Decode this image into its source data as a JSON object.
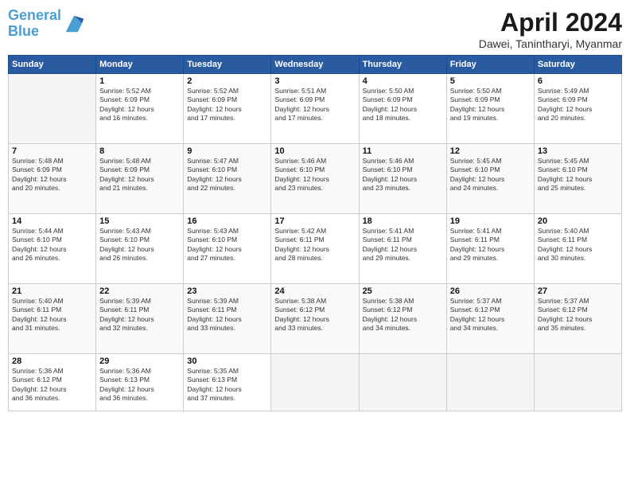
{
  "header": {
    "logo_line1": "General",
    "logo_line2": "Blue",
    "month": "April 2024",
    "location": "Dawei, Tanintharyi, Myanmar"
  },
  "columns": [
    "Sunday",
    "Monday",
    "Tuesday",
    "Wednesday",
    "Thursday",
    "Friday",
    "Saturday"
  ],
  "weeks": [
    [
      {
        "day": "",
        "info": ""
      },
      {
        "day": "1",
        "info": "Sunrise: 5:52 AM\nSunset: 6:09 PM\nDaylight: 12 hours\nand 16 minutes."
      },
      {
        "day": "2",
        "info": "Sunrise: 5:52 AM\nSunset: 6:09 PM\nDaylight: 12 hours\nand 17 minutes."
      },
      {
        "day": "3",
        "info": "Sunrise: 5:51 AM\nSunset: 6:09 PM\nDaylight: 12 hours\nand 17 minutes."
      },
      {
        "day": "4",
        "info": "Sunrise: 5:50 AM\nSunset: 6:09 PM\nDaylight: 12 hours\nand 18 minutes."
      },
      {
        "day": "5",
        "info": "Sunrise: 5:50 AM\nSunset: 6:09 PM\nDaylight: 12 hours\nand 19 minutes."
      },
      {
        "day": "6",
        "info": "Sunrise: 5:49 AM\nSunset: 6:09 PM\nDaylight: 12 hours\nand 20 minutes."
      }
    ],
    [
      {
        "day": "7",
        "info": "Sunrise: 5:48 AM\nSunset: 6:09 PM\nDaylight: 12 hours\nand 20 minutes."
      },
      {
        "day": "8",
        "info": "Sunrise: 5:48 AM\nSunset: 6:09 PM\nDaylight: 12 hours\nand 21 minutes."
      },
      {
        "day": "9",
        "info": "Sunrise: 5:47 AM\nSunset: 6:10 PM\nDaylight: 12 hours\nand 22 minutes."
      },
      {
        "day": "10",
        "info": "Sunrise: 5:46 AM\nSunset: 6:10 PM\nDaylight: 12 hours\nand 23 minutes."
      },
      {
        "day": "11",
        "info": "Sunrise: 5:46 AM\nSunset: 6:10 PM\nDaylight: 12 hours\nand 23 minutes."
      },
      {
        "day": "12",
        "info": "Sunrise: 5:45 AM\nSunset: 6:10 PM\nDaylight: 12 hours\nand 24 minutes."
      },
      {
        "day": "13",
        "info": "Sunrise: 5:45 AM\nSunset: 6:10 PM\nDaylight: 12 hours\nand 25 minutes."
      }
    ],
    [
      {
        "day": "14",
        "info": "Sunrise: 5:44 AM\nSunset: 6:10 PM\nDaylight: 12 hours\nand 26 minutes."
      },
      {
        "day": "15",
        "info": "Sunrise: 5:43 AM\nSunset: 6:10 PM\nDaylight: 12 hours\nand 26 minutes."
      },
      {
        "day": "16",
        "info": "Sunrise: 5:43 AM\nSunset: 6:10 PM\nDaylight: 12 hours\nand 27 minutes."
      },
      {
        "day": "17",
        "info": "Sunrise: 5:42 AM\nSunset: 6:11 PM\nDaylight: 12 hours\nand 28 minutes."
      },
      {
        "day": "18",
        "info": "Sunrise: 5:41 AM\nSunset: 6:11 PM\nDaylight: 12 hours\nand 29 minutes."
      },
      {
        "day": "19",
        "info": "Sunrise: 5:41 AM\nSunset: 6:11 PM\nDaylight: 12 hours\nand 29 minutes."
      },
      {
        "day": "20",
        "info": "Sunrise: 5:40 AM\nSunset: 6:11 PM\nDaylight: 12 hours\nand 30 minutes."
      }
    ],
    [
      {
        "day": "21",
        "info": "Sunrise: 5:40 AM\nSunset: 6:11 PM\nDaylight: 12 hours\nand 31 minutes."
      },
      {
        "day": "22",
        "info": "Sunrise: 5:39 AM\nSunset: 6:11 PM\nDaylight: 12 hours\nand 32 minutes."
      },
      {
        "day": "23",
        "info": "Sunrise: 5:39 AM\nSunset: 6:11 PM\nDaylight: 12 hours\nand 33 minutes."
      },
      {
        "day": "24",
        "info": "Sunrise: 5:38 AM\nSunset: 6:12 PM\nDaylight: 12 hours\nand 33 minutes."
      },
      {
        "day": "25",
        "info": "Sunrise: 5:38 AM\nSunset: 6:12 PM\nDaylight: 12 hours\nand 34 minutes."
      },
      {
        "day": "26",
        "info": "Sunrise: 5:37 AM\nSunset: 6:12 PM\nDaylight: 12 hours\nand 34 minutes."
      },
      {
        "day": "27",
        "info": "Sunrise: 5:37 AM\nSunset: 6:12 PM\nDaylight: 12 hours\nand 35 minutes."
      }
    ],
    [
      {
        "day": "28",
        "info": "Sunrise: 5:36 AM\nSunset: 6:12 PM\nDaylight: 12 hours\nand 36 minutes."
      },
      {
        "day": "29",
        "info": "Sunrise: 5:36 AM\nSunset: 6:13 PM\nDaylight: 12 hours\nand 36 minutes."
      },
      {
        "day": "30",
        "info": "Sunrise: 5:35 AM\nSunset: 6:13 PM\nDaylight: 12 hours\nand 37 minutes."
      },
      {
        "day": "",
        "info": ""
      },
      {
        "day": "",
        "info": ""
      },
      {
        "day": "",
        "info": ""
      },
      {
        "day": "",
        "info": ""
      }
    ]
  ]
}
